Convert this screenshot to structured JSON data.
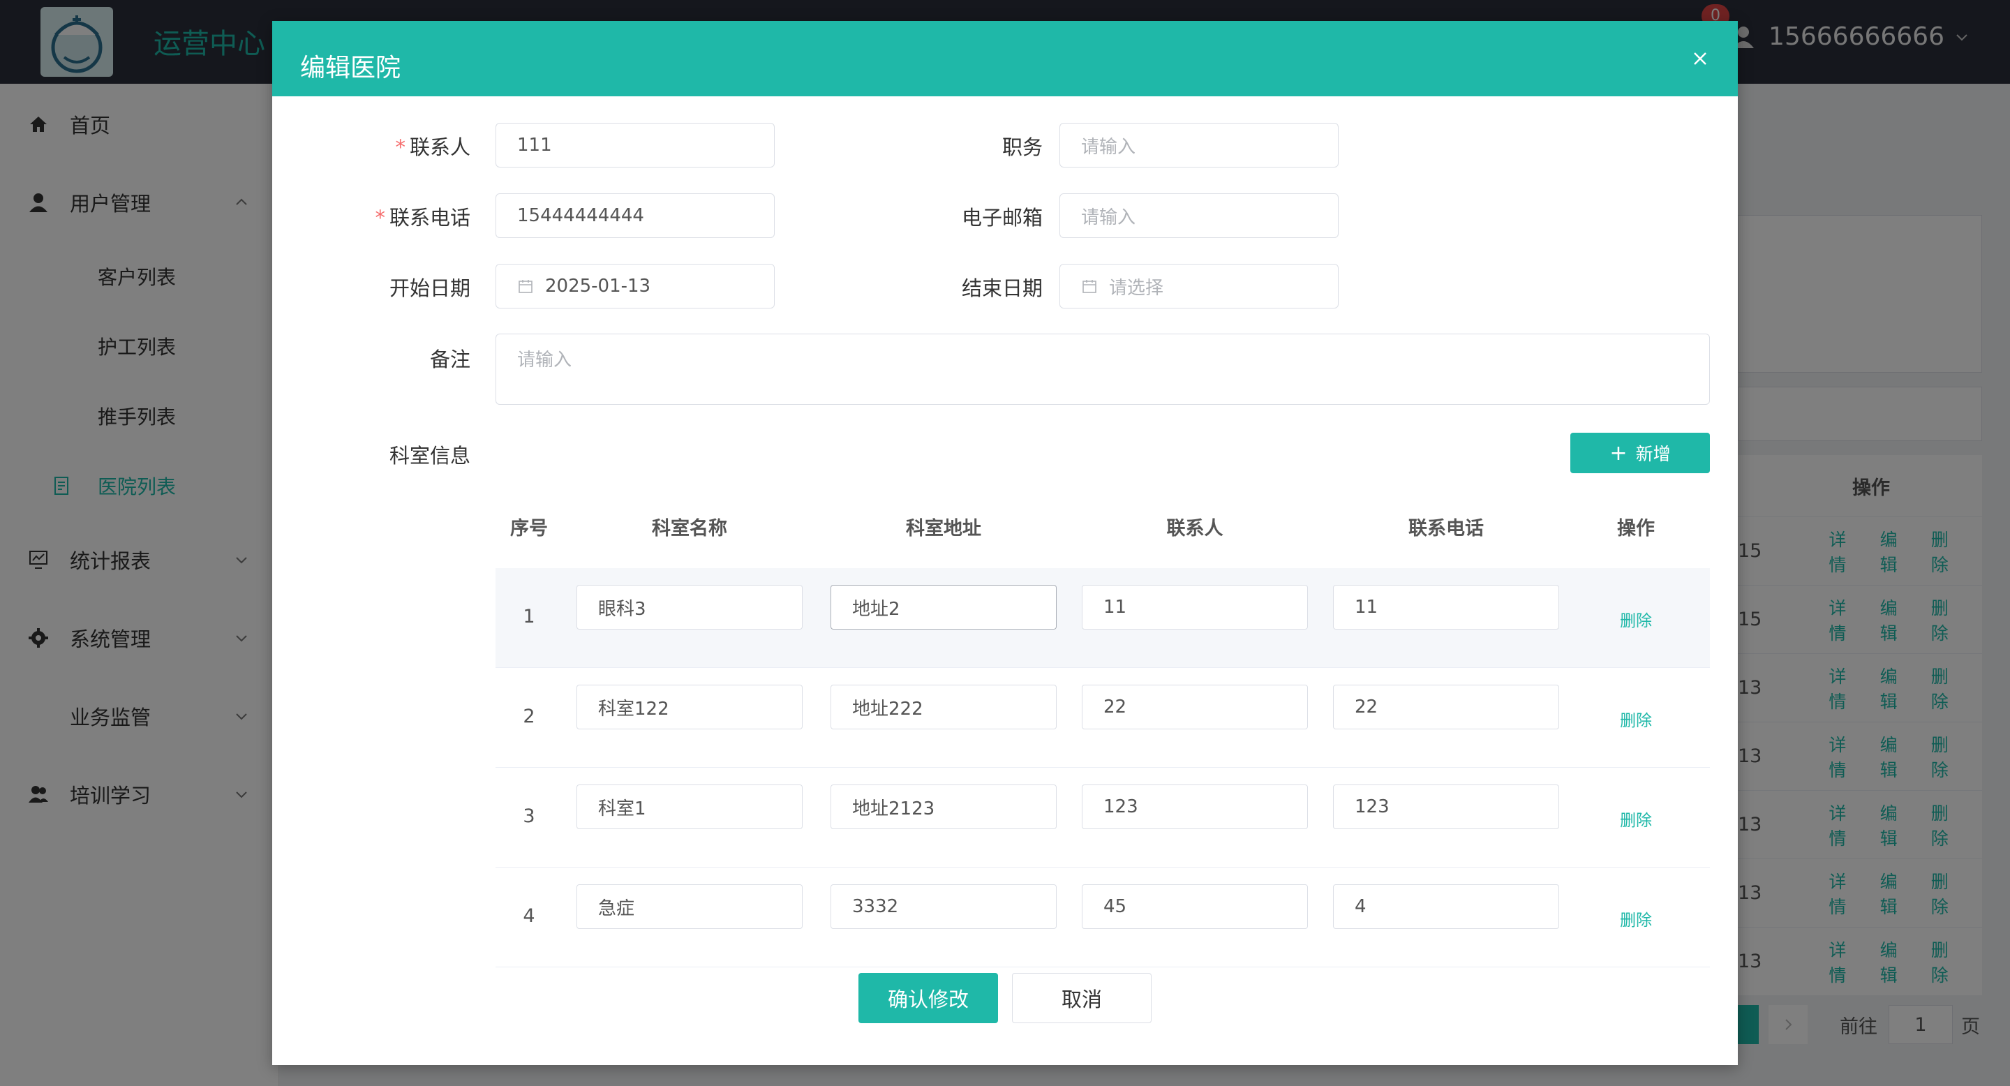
{
  "app": {
    "title": "运营中心",
    "notification_count": "0",
    "username": "15666666666"
  },
  "sidebar": {
    "items": [
      {
        "label": "首页",
        "icon": "home-icon"
      },
      {
        "label": "用户管理",
        "icon": "user-icon"
      },
      {
        "label": "客户列表"
      },
      {
        "label": "护工列表"
      },
      {
        "label": "推手列表"
      },
      {
        "label": "医院列表",
        "icon": "hospital-doc-icon"
      },
      {
        "label": "统计报表",
        "icon": "chart-icon"
      },
      {
        "label": "系统管理",
        "icon": "gear-icon"
      },
      {
        "label": "业务监管"
      },
      {
        "label": "培训学习",
        "icon": "group-icon"
      }
    ]
  },
  "background_table": {
    "header": "操作",
    "rows": [
      {
        "num": "15",
        "actions": [
          "详情",
          "编辑",
          "删除"
        ]
      },
      {
        "num": "15",
        "actions": [
          "详情",
          "编辑",
          "删除"
        ]
      },
      {
        "num": "13",
        "actions": [
          "详情",
          "编辑",
          "删除"
        ]
      },
      {
        "num": "13",
        "actions": [
          "详情",
          "编辑",
          "删除"
        ]
      },
      {
        "num": "13",
        "actions": [
          "详情",
          "编辑",
          "删除"
        ]
      },
      {
        "num": "13",
        "actions": [
          "详情",
          "编辑",
          "删除"
        ]
      },
      {
        "num": "13",
        "actions": [
          "详情",
          "编辑",
          "删除"
        ]
      }
    ],
    "pager": {
      "goto_label": "前往",
      "page": "1",
      "page_suffix": "页"
    }
  },
  "dialog": {
    "title": "编辑医院",
    "fields": {
      "contact": {
        "label": "联系人",
        "value": "111"
      },
      "position": {
        "label": "职务",
        "placeholder": "请输入"
      },
      "phone": {
        "label": "联系电话",
        "value": "15444444444"
      },
      "email": {
        "label": "电子邮箱",
        "placeholder": "请输入"
      },
      "start_date": {
        "label": "开始日期",
        "value": "2025-01-13"
      },
      "end_date": {
        "label": "结束日期",
        "placeholder": "请选择"
      },
      "remark": {
        "label": "备注",
        "placeholder": "请输入"
      }
    },
    "dept_section_label": "科室信息",
    "add_button": "新增",
    "table": {
      "headers": [
        "序号",
        "科室名称",
        "科室地址",
        "联系人",
        "联系电话",
        "操作"
      ],
      "rows": [
        {
          "no": "1",
          "name": "眼科3",
          "address": "地址2",
          "contact": "11",
          "phone": "11",
          "action": "删除"
        },
        {
          "no": "2",
          "name": "科室122",
          "address": "地址222",
          "contact": "22",
          "phone": "22",
          "action": "删除"
        },
        {
          "no": "3",
          "name": "科室1",
          "address": "地址2123",
          "contact": "123",
          "phone": "123",
          "action": "删除"
        },
        {
          "no": "4",
          "name": "急症",
          "address": "3332",
          "contact": "45",
          "phone": "4",
          "action": "删除"
        }
      ]
    },
    "confirm_button": "确认修改",
    "cancel_button": "取消"
  },
  "colors": {
    "accent": "#1fb8a8",
    "topbar": "#2b2f3a",
    "required": "#f56c6c"
  }
}
